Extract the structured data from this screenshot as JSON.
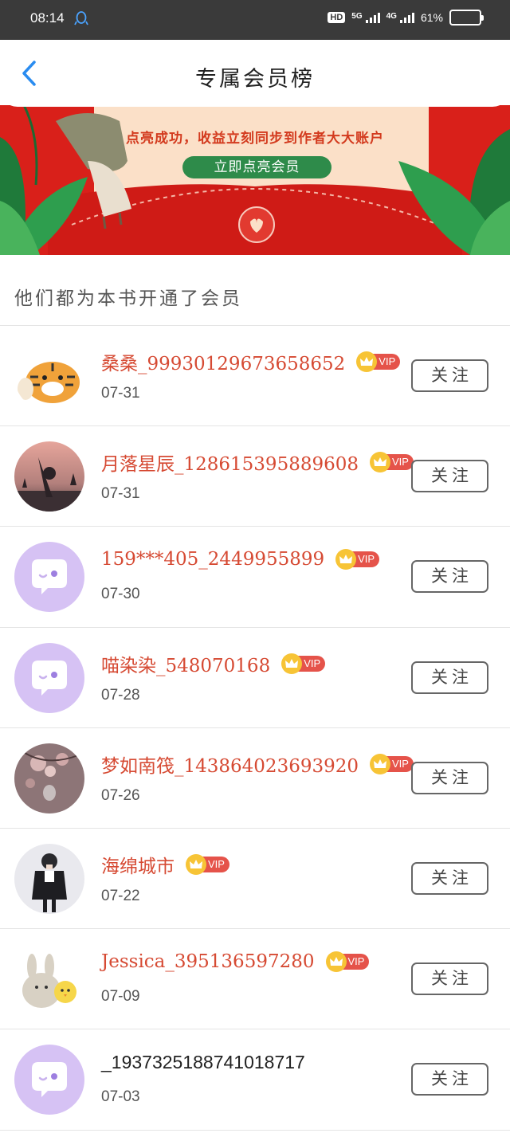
{
  "status_bar": {
    "time": "08:14",
    "hd": "HD",
    "net1": "5G",
    "net2": "4G",
    "battery_text": "61%",
    "battery_level": 0.61
  },
  "nav": {
    "title": "专属会员榜",
    "back_icon": "chevron-left-icon"
  },
  "banner": {
    "text": "点亮成功，收益立刻同步到作者大大账户",
    "button_label": "立即点亮会员",
    "colors": {
      "red": "#d9201a",
      "green": "#2e8b4a",
      "cream": "#fbe0c8"
    }
  },
  "section_title": "他们都为本书开通了会员",
  "members": [
    {
      "name": "桑桑_99930129673658652",
      "date": "07-31",
      "vip": "VIP",
      "follow": "关注",
      "avatar": "tiger",
      "name_style": "red"
    },
    {
      "name": "月落星辰_128615395889608",
      "date": "07-31",
      "vip": "VIP",
      "follow": "关注",
      "avatar": "sunset",
      "name_style": "red"
    },
    {
      "name": "159***405_2449955899",
      "date": "07-30",
      "vip": "VIP",
      "follow": "关注",
      "avatar": "default",
      "name_style": "red"
    },
    {
      "name": "喵染染_548070168",
      "date": "07-28",
      "vip": "VIP",
      "follow": "关注",
      "avatar": "default",
      "name_style": "red"
    },
    {
      "name": "梦如南筏_143864023693920",
      "date": "07-26",
      "vip": "VIP",
      "follow": "关注",
      "avatar": "blossom",
      "name_style": "red"
    },
    {
      "name": "海绵城市",
      "date": "07-22",
      "vip": "VIP",
      "follow": "关注",
      "avatar": "girl",
      "name_style": "red"
    },
    {
      "name": "Jessica_395136597280",
      "date": "07-09",
      "vip": "VIP",
      "follow": "关注",
      "avatar": "plush",
      "name_style": "red"
    },
    {
      "name": "_1937325188741018717",
      "date": "07-03",
      "vip": "",
      "follow": "关注",
      "avatar": "default",
      "name_style": "plain"
    }
  ]
}
